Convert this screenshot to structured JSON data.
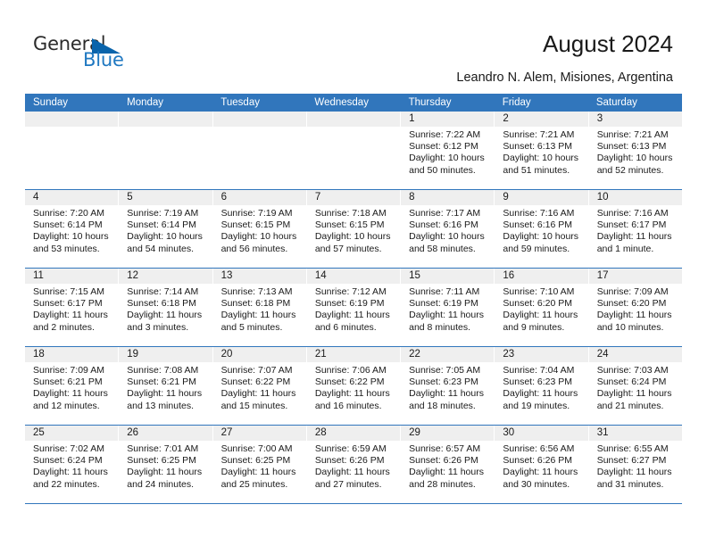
{
  "brand": {
    "name_part1": "General",
    "name_part2": "Blue"
  },
  "header": {
    "title": "August 2024",
    "subtitle": "Leandro N. Alem, Misiones, Argentina"
  },
  "theme": {
    "accent": "#3176bc",
    "brand_blue": "#1f78c1",
    "logo_triangle": "#0a64ab",
    "daynum_bg": "#efefef"
  },
  "weekdays": [
    "Sunday",
    "Monday",
    "Tuesday",
    "Wednesday",
    "Thursday",
    "Friday",
    "Saturday"
  ],
  "weeks": [
    [
      {
        "day": "",
        "empty": true
      },
      {
        "day": "",
        "empty": true
      },
      {
        "day": "",
        "empty": true
      },
      {
        "day": "",
        "empty": true
      },
      {
        "day": "1",
        "sunrise": "Sunrise: 7:22 AM",
        "sunset": "Sunset: 6:12 PM",
        "daylight": "Daylight: 10 hours and 50 minutes."
      },
      {
        "day": "2",
        "sunrise": "Sunrise: 7:21 AM",
        "sunset": "Sunset: 6:13 PM",
        "daylight": "Daylight: 10 hours and 51 minutes."
      },
      {
        "day": "3",
        "sunrise": "Sunrise: 7:21 AM",
        "sunset": "Sunset: 6:13 PM",
        "daylight": "Daylight: 10 hours and 52 minutes."
      }
    ],
    [
      {
        "day": "4",
        "sunrise": "Sunrise: 7:20 AM",
        "sunset": "Sunset: 6:14 PM",
        "daylight": "Daylight: 10 hours and 53 minutes."
      },
      {
        "day": "5",
        "sunrise": "Sunrise: 7:19 AM",
        "sunset": "Sunset: 6:14 PM",
        "daylight": "Daylight: 10 hours and 54 minutes."
      },
      {
        "day": "6",
        "sunrise": "Sunrise: 7:19 AM",
        "sunset": "Sunset: 6:15 PM",
        "daylight": "Daylight: 10 hours and 56 minutes."
      },
      {
        "day": "7",
        "sunrise": "Sunrise: 7:18 AM",
        "sunset": "Sunset: 6:15 PM",
        "daylight": "Daylight: 10 hours and 57 minutes."
      },
      {
        "day": "8",
        "sunrise": "Sunrise: 7:17 AM",
        "sunset": "Sunset: 6:16 PM",
        "daylight": "Daylight: 10 hours and 58 minutes."
      },
      {
        "day": "9",
        "sunrise": "Sunrise: 7:16 AM",
        "sunset": "Sunset: 6:16 PM",
        "daylight": "Daylight: 10 hours and 59 minutes."
      },
      {
        "day": "10",
        "sunrise": "Sunrise: 7:16 AM",
        "sunset": "Sunset: 6:17 PM",
        "daylight": "Daylight: 11 hours and 1 minute."
      }
    ],
    [
      {
        "day": "11",
        "sunrise": "Sunrise: 7:15 AM",
        "sunset": "Sunset: 6:17 PM",
        "daylight": "Daylight: 11 hours and 2 minutes."
      },
      {
        "day": "12",
        "sunrise": "Sunrise: 7:14 AM",
        "sunset": "Sunset: 6:18 PM",
        "daylight": "Daylight: 11 hours and 3 minutes."
      },
      {
        "day": "13",
        "sunrise": "Sunrise: 7:13 AM",
        "sunset": "Sunset: 6:18 PM",
        "daylight": "Daylight: 11 hours and 5 minutes."
      },
      {
        "day": "14",
        "sunrise": "Sunrise: 7:12 AM",
        "sunset": "Sunset: 6:19 PM",
        "daylight": "Daylight: 11 hours and 6 minutes."
      },
      {
        "day": "15",
        "sunrise": "Sunrise: 7:11 AM",
        "sunset": "Sunset: 6:19 PM",
        "daylight": "Daylight: 11 hours and 8 minutes."
      },
      {
        "day": "16",
        "sunrise": "Sunrise: 7:10 AM",
        "sunset": "Sunset: 6:20 PM",
        "daylight": "Daylight: 11 hours and 9 minutes."
      },
      {
        "day": "17",
        "sunrise": "Sunrise: 7:09 AM",
        "sunset": "Sunset: 6:20 PM",
        "daylight": "Daylight: 11 hours and 10 minutes."
      }
    ],
    [
      {
        "day": "18",
        "sunrise": "Sunrise: 7:09 AM",
        "sunset": "Sunset: 6:21 PM",
        "daylight": "Daylight: 11 hours and 12 minutes."
      },
      {
        "day": "19",
        "sunrise": "Sunrise: 7:08 AM",
        "sunset": "Sunset: 6:21 PM",
        "daylight": "Daylight: 11 hours and 13 minutes."
      },
      {
        "day": "20",
        "sunrise": "Sunrise: 7:07 AM",
        "sunset": "Sunset: 6:22 PM",
        "daylight": "Daylight: 11 hours and 15 minutes."
      },
      {
        "day": "21",
        "sunrise": "Sunrise: 7:06 AM",
        "sunset": "Sunset: 6:22 PM",
        "daylight": "Daylight: 11 hours and 16 minutes."
      },
      {
        "day": "22",
        "sunrise": "Sunrise: 7:05 AM",
        "sunset": "Sunset: 6:23 PM",
        "daylight": "Daylight: 11 hours and 18 minutes."
      },
      {
        "day": "23",
        "sunrise": "Sunrise: 7:04 AM",
        "sunset": "Sunset: 6:23 PM",
        "daylight": "Daylight: 11 hours and 19 minutes."
      },
      {
        "day": "24",
        "sunrise": "Sunrise: 7:03 AM",
        "sunset": "Sunset: 6:24 PM",
        "daylight": "Daylight: 11 hours and 21 minutes."
      }
    ],
    [
      {
        "day": "25",
        "sunrise": "Sunrise: 7:02 AM",
        "sunset": "Sunset: 6:24 PM",
        "daylight": "Daylight: 11 hours and 22 minutes."
      },
      {
        "day": "26",
        "sunrise": "Sunrise: 7:01 AM",
        "sunset": "Sunset: 6:25 PM",
        "daylight": "Daylight: 11 hours and 24 minutes."
      },
      {
        "day": "27",
        "sunrise": "Sunrise: 7:00 AM",
        "sunset": "Sunset: 6:25 PM",
        "daylight": "Daylight: 11 hours and 25 minutes."
      },
      {
        "day": "28",
        "sunrise": "Sunrise: 6:59 AM",
        "sunset": "Sunset: 6:26 PM",
        "daylight": "Daylight: 11 hours and 27 minutes."
      },
      {
        "day": "29",
        "sunrise": "Sunrise: 6:57 AM",
        "sunset": "Sunset: 6:26 PM",
        "daylight": "Daylight: 11 hours and 28 minutes."
      },
      {
        "day": "30",
        "sunrise": "Sunrise: 6:56 AM",
        "sunset": "Sunset: 6:26 PM",
        "daylight": "Daylight: 11 hours and 30 minutes."
      },
      {
        "day": "31",
        "sunrise": "Sunrise: 6:55 AM",
        "sunset": "Sunset: 6:27 PM",
        "daylight": "Daylight: 11 hours and 31 minutes."
      }
    ]
  ]
}
